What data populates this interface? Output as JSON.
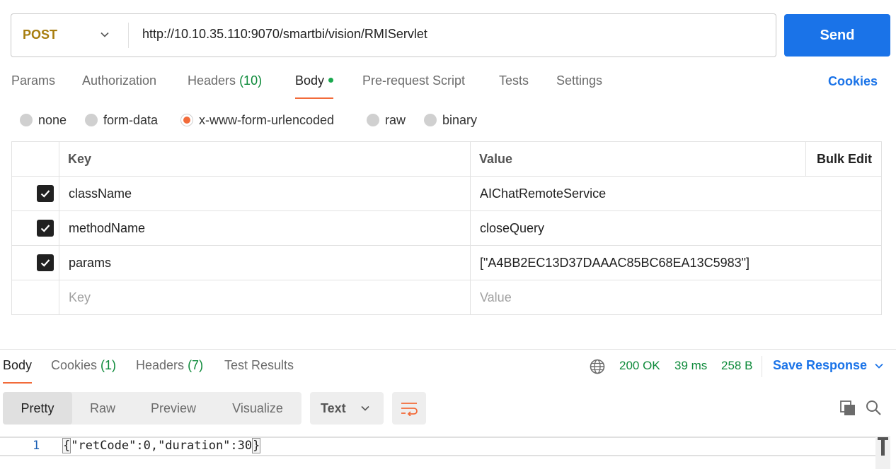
{
  "request": {
    "method": "POST",
    "url": "http://10.10.35.110:9070/smartbi/vision/RMIServlet",
    "send_label": "Send"
  },
  "request_tabs": [
    {
      "label": "Params"
    },
    {
      "label": "Authorization"
    },
    {
      "label": "Headers",
      "count": "(10)"
    },
    {
      "label": "Body"
    },
    {
      "label": "Pre-request Script"
    },
    {
      "label": "Tests"
    },
    {
      "label": "Settings"
    }
  ],
  "cookies_label": "Cookies",
  "body_types": [
    "none",
    "form-data",
    "x-www-form-urlencoded",
    "raw",
    "binary"
  ],
  "body_type_selected": "x-www-form-urlencoded",
  "table": {
    "headers": {
      "key": "Key",
      "value": "Value",
      "bulk_edit": "Bulk Edit"
    },
    "rows": [
      {
        "key": "className",
        "value": "AIChatRemoteService",
        "checked": true
      },
      {
        "key": "methodName",
        "value": "closeQuery",
        "checked": true
      },
      {
        "key": "params",
        "value": "[\"A4BB2EC13D37DAAAC85BC68EA13C5983\"]",
        "checked": true
      }
    ],
    "placeholder": {
      "key": "Key",
      "value": "Value"
    }
  },
  "response_tabs": [
    {
      "label": "Body"
    },
    {
      "label": "Cookies",
      "count": "(1)"
    },
    {
      "label": "Headers",
      "count": "(7)"
    },
    {
      "label": "Test Results"
    }
  ],
  "response_status": {
    "status": "200 OK",
    "time": "39 ms",
    "size": "258 B"
  },
  "save_response_label": "Save Response",
  "view_modes": [
    "Pretty",
    "Raw",
    "Preview",
    "Visualize"
  ],
  "format": "Text",
  "code": {
    "line_number": "1",
    "open_brace": "{",
    "body": "\"retCode\":0,\"duration\":30",
    "close_brace": "}"
  },
  "colors": {
    "accent": "#1a73e8",
    "active_underline": "#f26b3a",
    "method": "#a77d0e",
    "success": "#0d8a3a"
  }
}
